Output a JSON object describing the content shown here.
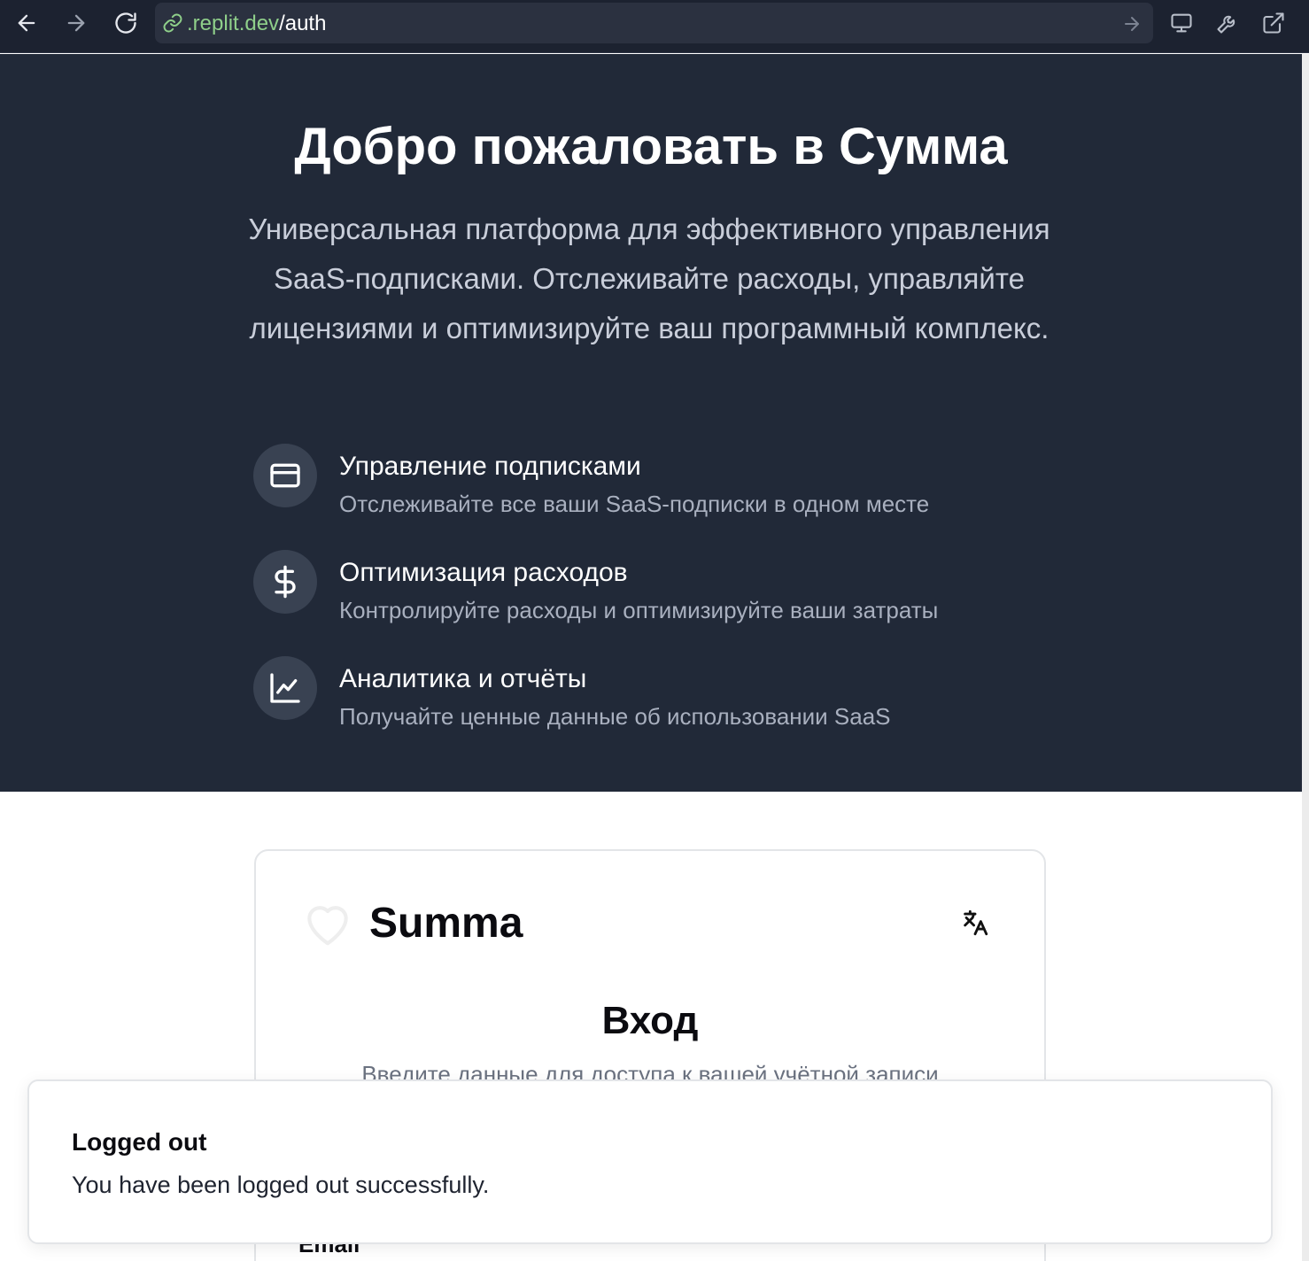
{
  "browser": {
    "url_domain": ".replit.dev",
    "url_path": "/auth"
  },
  "hero": {
    "title": "Добро пожаловать в Сумма",
    "description": "Универсальная платформа для эффективного управления SaaS-подписками. Отслеживайте расходы, управляйте лицензиями и оптимизируйте ваш программный комплекс.",
    "features": [
      {
        "icon": "credit-card-icon",
        "title": "Управление подписками",
        "description": "Отслеживайте все ваши SaaS-подписки в одном месте"
      },
      {
        "icon": "dollar-sign-icon",
        "title": "Оптимизация расходов",
        "description": "Контролируйте расходы и оптимизируйте ваши затраты"
      },
      {
        "icon": "line-chart-icon",
        "title": "Аналитика и отчёты",
        "description": "Получайте ценные данные об использовании SaaS"
      }
    ]
  },
  "card": {
    "brand_name": "Summa",
    "brand_icon": "heart-icon",
    "language_icon": "translate-icon",
    "login_title": "Вход",
    "login_subtitle": "Введите данные для доступа к вашей учётной записи",
    "email_label": "Email"
  },
  "toast": {
    "title": "Logged out",
    "description": "You have been logged out successfully."
  },
  "colors": {
    "toolbar_bg": "#1c2230",
    "hero_bg": "#212938",
    "icon_circle": "#394252",
    "url_domain": "#8fcf8a"
  }
}
